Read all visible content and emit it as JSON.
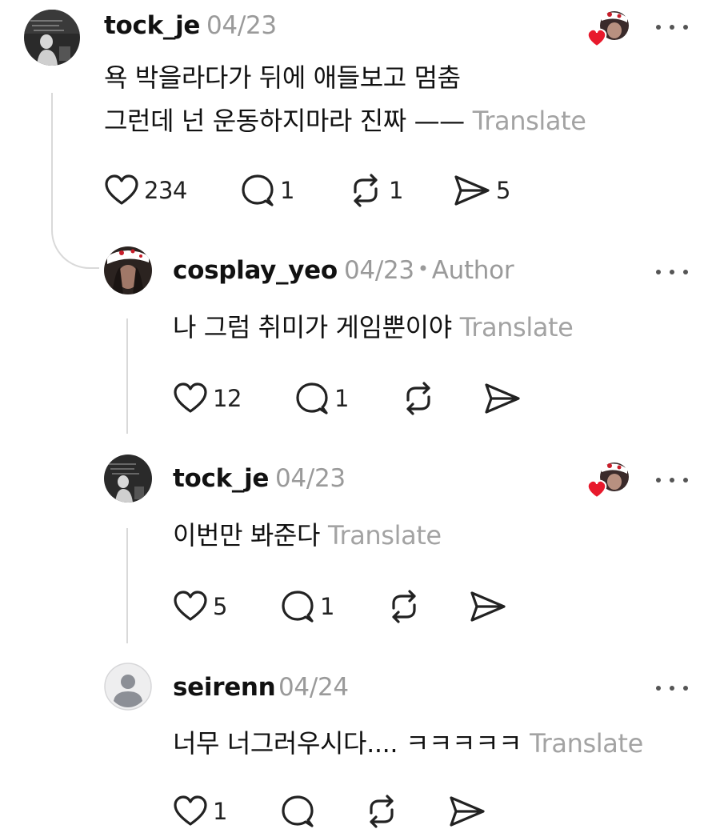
{
  "comments": [
    {
      "username": "tock_je",
      "date": "04/23",
      "author_tag": "",
      "lines": [
        "욕 박을라다가 뒤에 애들보고 멈춤",
        "그런데 넌 운동하지마라 진짜 ——"
      ],
      "translate": "Translate",
      "likes": "234",
      "replies": "1",
      "reposts": "1",
      "shares": "5",
      "liked_by_author": true
    },
    {
      "username": "cosplay_yeo",
      "date": "04/23",
      "separator": "•",
      "author_tag": "Author",
      "lines": [
        "나 그럼 취미가 게임뿐이야"
      ],
      "translate": "Translate",
      "likes": "12",
      "replies": "1",
      "reposts": "",
      "shares": "",
      "liked_by_author": false
    },
    {
      "username": "tock_je",
      "date": "04/23",
      "author_tag": "",
      "lines": [
        "이번만 봐준다"
      ],
      "translate": "Translate",
      "likes": "5",
      "replies": "1",
      "reposts": "",
      "shares": "",
      "liked_by_author": true
    },
    {
      "username": "seirenn",
      "date": "04/24",
      "author_tag": "",
      "lines": [
        "너무 너그러우시다.... ㅋㅋㅋㅋㅋ"
      ],
      "translate": "Translate",
      "likes": "1",
      "replies": "",
      "reposts": "",
      "shares": "",
      "liked_by_author": false
    }
  ],
  "icons": {
    "like": "heart-icon",
    "reply": "speech-bubble-icon",
    "repost": "repost-icon",
    "share": "send-icon",
    "more": "more-dots-icon",
    "liked_badge": "red-heart-icon"
  },
  "colors": {
    "liked_heart": "#e8192c",
    "muted_text": "#9a9a9a",
    "thread_line": "#d9d9d9"
  }
}
